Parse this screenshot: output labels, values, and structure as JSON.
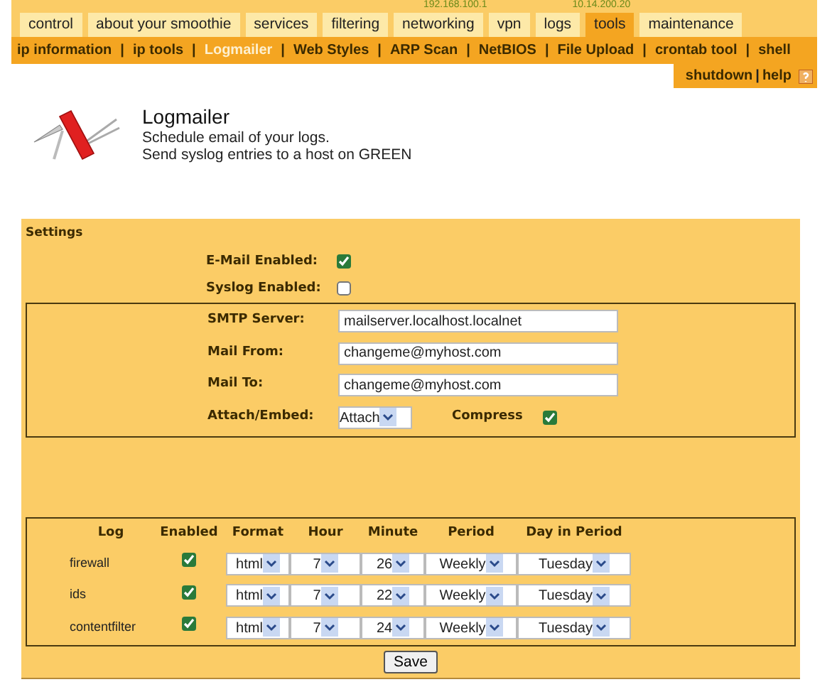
{
  "top_info": [
    "192.168.100.1",
    "10.14.200.20"
  ],
  "tabs": [
    {
      "label": "control",
      "selected": false
    },
    {
      "label": "about your smoothie",
      "selected": false
    },
    {
      "label": "services",
      "selected": false
    },
    {
      "label": "filtering",
      "selected": false
    },
    {
      "label": "networking",
      "selected": false
    },
    {
      "label": "vpn",
      "selected": false
    },
    {
      "label": "logs",
      "selected": false
    },
    {
      "label": "tools",
      "selected": true
    },
    {
      "label": "maintenance",
      "selected": false
    }
  ],
  "subnav": {
    "separator": "|",
    "items": [
      {
        "label": "ip information",
        "selected": false
      },
      {
        "label": "ip tools",
        "selected": false
      },
      {
        "label": "Logmailer",
        "selected": true
      },
      {
        "label": "Web Styles",
        "selected": false
      },
      {
        "label": "ARP Scan",
        "selected": false
      },
      {
        "label": "NetBIOS",
        "selected": false
      },
      {
        "label": "File Upload",
        "selected": false
      },
      {
        "label": "crontab tool",
        "selected": false
      },
      {
        "label": "shell",
        "selected": false
      }
    ]
  },
  "utility": {
    "separator": "|",
    "links": [
      "shutdown",
      "help"
    ]
  },
  "header": {
    "title": "Logmailer",
    "lines": [
      "Schedule email of your logs.",
      "Send syslog entries to a host on GREEN"
    ]
  },
  "settings": {
    "title": "Settings",
    "toggles": [
      {
        "label": "E-Mail Enabled:",
        "checked": true
      },
      {
        "label": "Syslog Enabled:",
        "checked": false
      }
    ],
    "fields": [
      {
        "label": "SMTP Server:",
        "value": "mailserver.localhost.localnet"
      },
      {
        "label": "Mail From:",
        "value": "changeme@myhost.com"
      },
      {
        "label": "Mail To:",
        "value": "changeme@myhost.com"
      }
    ],
    "attach": {
      "label": "Attach/Embed:",
      "value": "Attach"
    },
    "compress": {
      "label": "Compress",
      "checked": true
    }
  },
  "logs": {
    "columns": [
      "Log",
      "Enabled",
      "Format",
      "Hour",
      "Minute",
      "Period",
      "Day in Period"
    ],
    "rows": [
      {
        "name": "firewall",
        "enabled": true,
        "format": "html",
        "hour": "7",
        "minute": "26",
        "period": "Weekly",
        "day": "Tuesday"
      },
      {
        "name": "ids",
        "enabled": true,
        "format": "html",
        "hour": "7",
        "minute": "22",
        "period": "Weekly",
        "day": "Tuesday"
      },
      {
        "name": "contentfilter",
        "enabled": true,
        "format": "html",
        "hour": "7",
        "minute": "24",
        "period": "Weekly",
        "day": "Tuesday"
      }
    ]
  },
  "save": "Save"
}
